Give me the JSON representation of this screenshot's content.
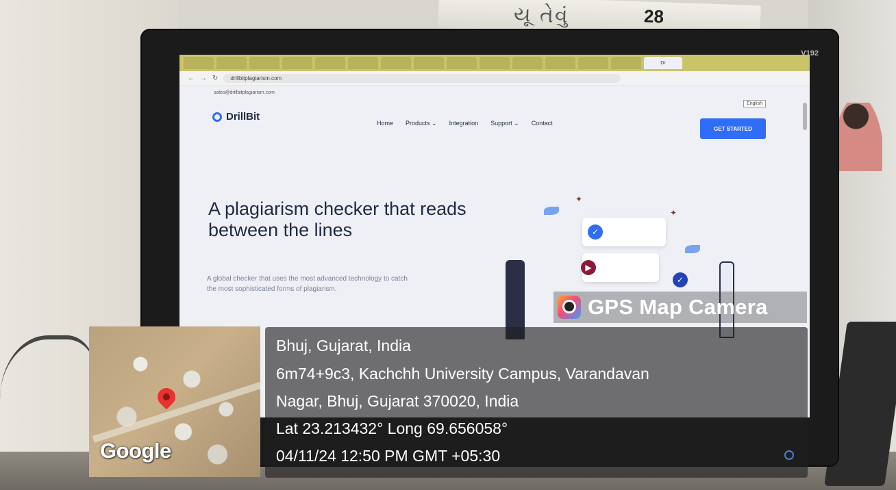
{
  "monitor": {
    "model": "V192"
  },
  "browser": {
    "tabs": [
      "",
      "",
      "",
      "",
      "",
      "",
      "",
      "",
      "",
      "",
      "",
      "",
      "",
      "",
      "Dr"
    ],
    "url": "drillbitplagiarism.com",
    "email": "sales@drillbitplagiarism.com",
    "language": "English"
  },
  "site": {
    "brand": "DrillBit",
    "nav": [
      "Home",
      "Products ⌄",
      "Integration",
      "Support ⌄",
      "Contact"
    ],
    "cta": "GET STARTED",
    "hero_title": "A plagiarism checker that reads between the lines",
    "hero_sub": "A global checker that uses the most advanced technology to catch the most sophisticated forms of plagiarism."
  },
  "gps": {
    "brand": "GPS Map Camera",
    "city": "Bhuj, Gujarat, India",
    "address_line1": "6m74+9c3, Kachchh University Campus, Varandavan",
    "address_line2": "Nagar, Bhuj, Gujarat 370020, India",
    "coords": "Lat 23.213432° Long 69.656058°",
    "datetime": "04/11/24 12:50 PM GMT +05:30",
    "map_label": "Google"
  },
  "colors": {
    "accent": "#2f6df6",
    "pin": "#e8322f"
  }
}
